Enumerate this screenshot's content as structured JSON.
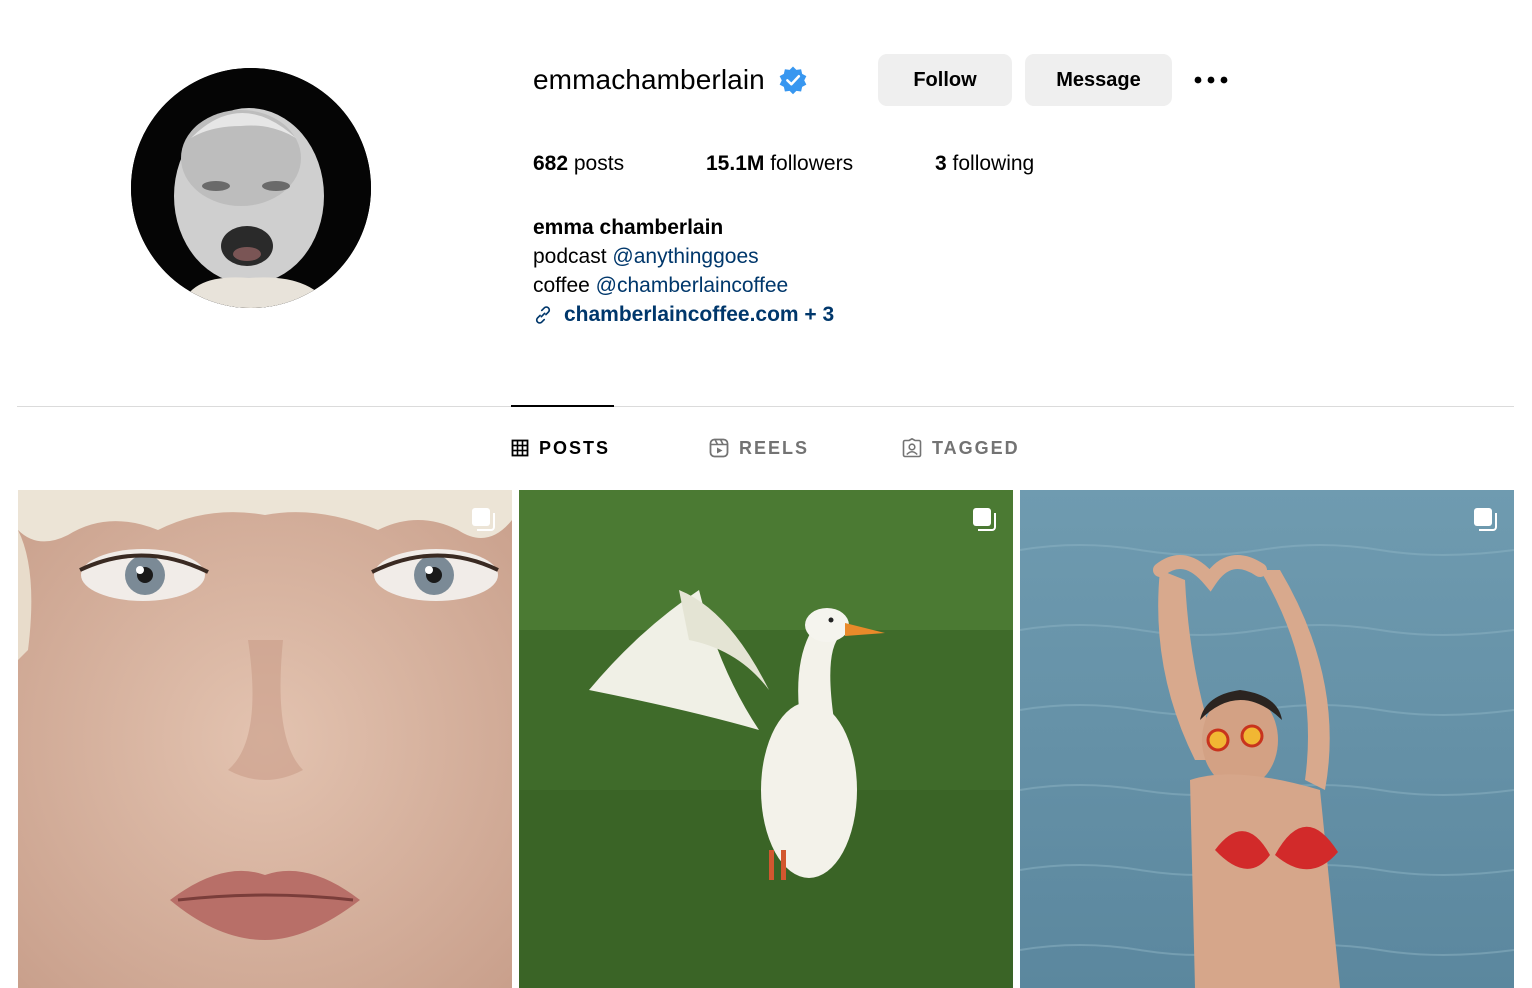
{
  "profile": {
    "username": "emmachamberlain",
    "verified": true,
    "avatar_alt": "profile-picture",
    "follow_label": "Follow",
    "message_label": "Message",
    "more_icon": "more-options-icon"
  },
  "stats": {
    "posts_count": "682",
    "posts_label": " posts",
    "followers_count": "15.1M",
    "followers_label": " followers",
    "following_count": "3",
    "following_label": " following"
  },
  "bio": {
    "name": "emma chamberlain",
    "line1_prefix": "podcast ",
    "line1_mention": "@anythinggoes",
    "line2_prefix": "coffee ",
    "line2_mention": "@chamberlaincoffee",
    "link_text": "chamberlaincoffee.com + 3"
  },
  "tabs": [
    {
      "label": "POSTS",
      "icon": "grid-icon",
      "active": true
    },
    {
      "label": "REELS",
      "icon": "reels-icon",
      "active": false
    },
    {
      "label": "TAGGED",
      "icon": "tagged-icon",
      "active": false
    }
  ],
  "posts": [
    {
      "subject": "face close-up",
      "multi": true
    },
    {
      "subject": "white duck on grass",
      "multi": true
    },
    {
      "subject": "person in sea with goggles",
      "multi": true
    }
  ],
  "colors": {
    "verified": "#3897f0",
    "link": "#00376b",
    "button_bg": "#efefef",
    "divider": "#dbdbdb",
    "inactive_tab": "#737373"
  }
}
